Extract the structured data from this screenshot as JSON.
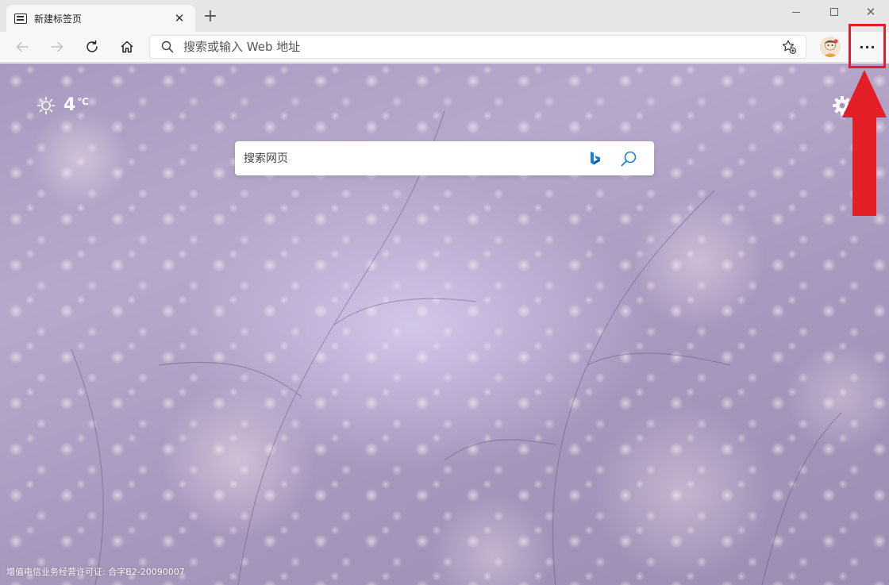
{
  "tab": {
    "favicon": "new-tab-page-icon",
    "title": "新建标签页",
    "close_glyph": "✕"
  },
  "new_tab_glyph": "+",
  "window_controls": {
    "close_glyph": "✕"
  },
  "toolbar": {
    "address_placeholder": "搜索或输入 Web 地址",
    "more_glyph": "···"
  },
  "newtab": {
    "weather": {
      "icon": "sun-icon",
      "temperature": "4",
      "unit": "℃"
    },
    "search_placeholder": "搜索网页",
    "license_text": "增值电信业务经营许可证: 合字B2-20090007"
  },
  "annotation": {
    "color": "#e41e26"
  }
}
